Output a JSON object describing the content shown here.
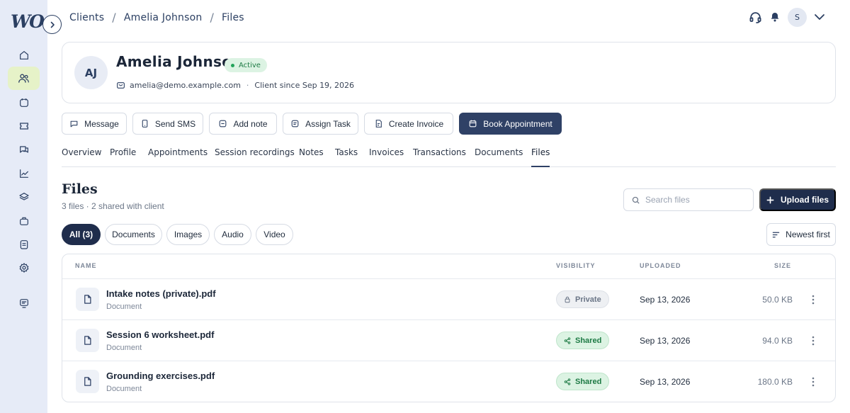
{
  "brand": {
    "logo_text": "WO"
  },
  "breadcrumb": [
    "Clients",
    "Amelia Johnson",
    "Files"
  ],
  "user": {
    "avatar_initial": "S"
  },
  "sidebar": {
    "items": [
      {
        "name": "home",
        "icon": "home-icon"
      },
      {
        "name": "clients",
        "icon": "users-icon",
        "active": true
      },
      {
        "name": "calendar",
        "icon": "calendar-icon"
      },
      {
        "name": "billing",
        "icon": "ticket-icon"
      },
      {
        "name": "messages",
        "icon": "chat-icon"
      },
      {
        "name": "reports",
        "icon": "chart-icon"
      },
      {
        "name": "resources",
        "icon": "layers-icon"
      },
      {
        "name": "services",
        "icon": "briefcase-icon"
      },
      {
        "name": "tasks",
        "icon": "checklist-icon"
      },
      {
        "name": "settings",
        "icon": "gear-icon"
      },
      {
        "name": "support",
        "icon": "monitor-icon"
      }
    ]
  },
  "client": {
    "initials": "AJ",
    "name": "Amelia Johnson",
    "status": "Active",
    "email": "amelia@demo.example.com",
    "since": "Client since Sep 19, 2026"
  },
  "actions": {
    "message": "Message",
    "send_sms": "Send SMS",
    "add_note": "Add note",
    "assign_task": "Assign Task",
    "create_invoice": "Create Invoice",
    "book_appointment": "Book Appointment"
  },
  "tabs": [
    "Overview",
    "Profile",
    "Appointments",
    "Session recordings",
    "Notes",
    "Tasks",
    "Invoices",
    "Transactions",
    "Documents",
    "Files"
  ],
  "active_tab": "Files",
  "files": {
    "title": "Files",
    "subtitle": "3 files · 2 shared with client",
    "search_placeholder": "Search files",
    "upload_label": "Upload files",
    "filters": [
      "All (3)",
      "Documents",
      "Images",
      "Audio",
      "Video"
    ],
    "active_filter": "All (3)",
    "sort_label": "Newest first",
    "columns": {
      "name": "NAME",
      "visibility": "VISIBILITY",
      "uploaded": "UPLOADED",
      "size": "SIZE"
    },
    "rows": [
      {
        "name": "Intake notes (private).pdf",
        "type": "Document",
        "visibility": "Private",
        "uploaded": "Sep 13, 2026",
        "size": "50.0 KB"
      },
      {
        "name": "Session 6 worksheet.pdf",
        "type": "Document",
        "visibility": "Shared",
        "uploaded": "Sep 13, 2026",
        "size": "94.0 KB"
      },
      {
        "name": "Grounding exercises.pdf",
        "type": "Document",
        "visibility": "Shared",
        "uploaded": "Sep 13, 2026",
        "size": "180.0 KB"
      }
    ]
  },
  "colors": {
    "sidebar_bg": "#e6ebf7",
    "sidebar_active": "#e6f2c8",
    "primary": "#2f4166",
    "primary_dark": "#1f2d4c",
    "success_bg": "#dcf3e3",
    "success_text": "#1d7a44"
  }
}
